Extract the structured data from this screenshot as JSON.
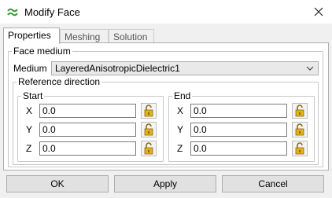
{
  "window": {
    "title": "Modify Face",
    "icon": "app-logo-icon"
  },
  "tabs": [
    {
      "label": "Properties",
      "active": true
    },
    {
      "label": "Meshing",
      "active": false
    },
    {
      "label": "Solution",
      "active": false
    }
  ],
  "face_medium": {
    "legend": "Face medium",
    "medium_label": "Medium",
    "medium_value": "LayeredAnisotropicDielectric1"
  },
  "reference_direction": {
    "legend": "Reference direction",
    "start": {
      "legend": "Start",
      "x_label": "X",
      "x_value": "0.0",
      "y_label": "Y",
      "y_value": "0.0",
      "z_label": "Z",
      "z_value": "0.0"
    },
    "end": {
      "legend": "End",
      "x_label": "X",
      "x_value": "0.0",
      "y_label": "Y",
      "y_value": "0.0",
      "z_label": "Z",
      "z_value": "0.0"
    }
  },
  "buttons": {
    "ok": "OK",
    "apply": "Apply",
    "cancel": "Cancel"
  },
  "colors": {
    "lock_body": "#e3b118",
    "lock_shackle": "#8a6a10",
    "logo": "#3a9a3a"
  }
}
